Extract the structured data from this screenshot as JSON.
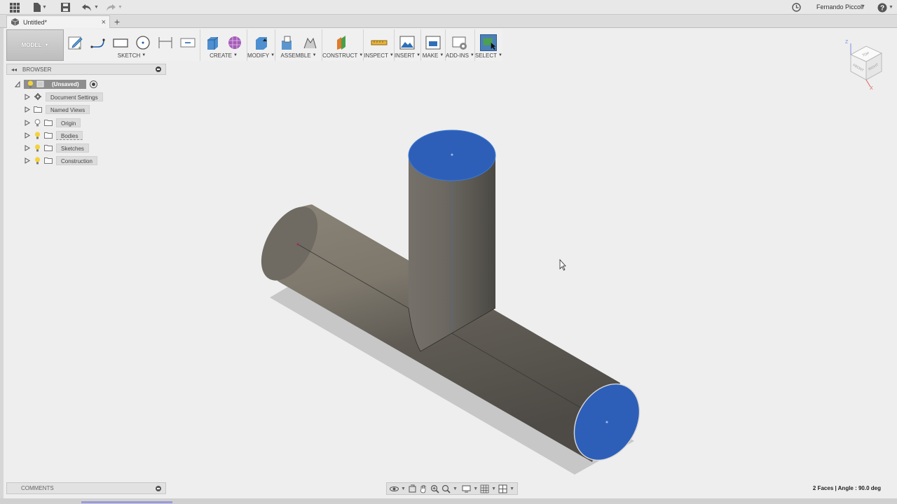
{
  "app": {
    "user_name": "Fernando Piccoli",
    "doc_tab_title": "Untitled*"
  },
  "toolbar": {
    "workspace": "MODEL",
    "groups": [
      {
        "label": "SKETCH"
      },
      {
        "label": "CREATE"
      },
      {
        "label": "MODIFY"
      },
      {
        "label": "ASSEMBLE"
      },
      {
        "label": "CONSTRUCT"
      },
      {
        "label": "INSPECT"
      },
      {
        "label": "INSERT"
      },
      {
        "label": "MAKE"
      },
      {
        "label": "ADD-INS"
      },
      {
        "label": "SELECT"
      }
    ]
  },
  "browser": {
    "title": "BROWSER",
    "root": "(Unsaved)",
    "nodes": [
      {
        "label": "Document Settings",
        "icon": "gear-icon"
      },
      {
        "label": "Named Views",
        "icon": "folder-icon"
      },
      {
        "label": "Origin",
        "icon": "folder-icon"
      },
      {
        "label": "Bodies",
        "icon": "folder-icon"
      },
      {
        "label": "Sketches",
        "icon": "folder-icon"
      },
      {
        "label": "Construction",
        "icon": "folder-icon"
      }
    ]
  },
  "comments": {
    "title": "COMMENTS"
  },
  "status": {
    "text": "2 Faces | Angle : 90.0 deg"
  },
  "viewcube": {
    "faces": [
      "TOP",
      "FRONT",
      "RIGHT"
    ],
    "axes": [
      "Z",
      "X"
    ]
  },
  "colors": {
    "selected_face": "#2e5fb8",
    "body": "#6e6a62",
    "accent": "#3a6fb0"
  }
}
